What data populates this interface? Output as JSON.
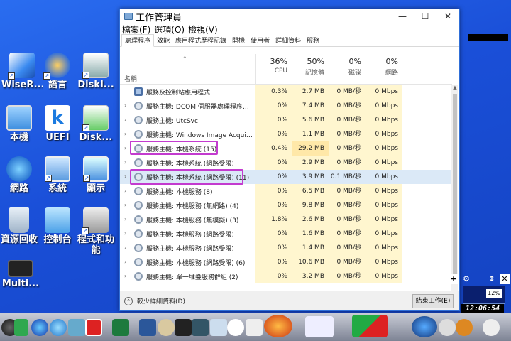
{
  "desktop": {
    "icons": [
      {
        "label": "WiseR..."
      },
      {
        "label": "語言"
      },
      {
        "label": "DiskI..."
      },
      {
        "label": "本機"
      },
      {
        "label": "UEFI"
      },
      {
        "label": "Disk..."
      },
      {
        "label": "網路"
      },
      {
        "label": "系統"
      },
      {
        "label": "顯示"
      },
      {
        "label": "資源回收"
      },
      {
        "label": "控制台"
      },
      {
        "label": "程式和功能"
      },
      {
        "label": "Multi..."
      }
    ]
  },
  "window": {
    "title": "工作管理員",
    "menu": [
      "檔案(F)",
      "選項(O)",
      "檢視(V)"
    ],
    "tabs": [
      "處理程序",
      "效能",
      "應用程式歷程記錄",
      "開機",
      "使用者",
      "詳細資料",
      "服務"
    ],
    "headers": {
      "name": "名稱",
      "cpu_pct": "36%",
      "cpu": "CPU",
      "mem_pct": "50%",
      "mem": "記憶體",
      "disk_pct": "0%",
      "disk": "磁碟",
      "net_pct": "0%",
      "net": "網路"
    },
    "rows": [
      {
        "name": "服務及控制站應用程式",
        "cpu": "0.3%",
        "mem": "2.7 MB",
        "disk": "0 MB/秒",
        "net": "0 Mbps"
      },
      {
        "name": "服務主機: DCOM 伺服器處理程序啟...",
        "cpu": "0%",
        "mem": "7.4 MB",
        "disk": "0 MB/秒",
        "net": "0 Mbps"
      },
      {
        "name": "服務主機: UtcSvc",
        "cpu": "0%",
        "mem": "5.6 MB",
        "disk": "0 MB/秒",
        "net": "0 Mbps"
      },
      {
        "name": "服務主機: Windows Image Acquisitio...",
        "cpu": "0%",
        "mem": "1.1 MB",
        "disk": "0 MB/秒",
        "net": "0 Mbps"
      },
      {
        "name": "服務主機: 本機系統 (15)",
        "cpu": "0.4%",
        "mem": "29.2 MB",
        "disk": "0 MB/秒",
        "net": "0 Mbps"
      },
      {
        "name": "服務主機: 本機系統 (網路受限)",
        "cpu": "0%",
        "mem": "2.9 MB",
        "disk": "0 MB/秒",
        "net": "0 Mbps"
      },
      {
        "name": "服務主機: 本機系統 (網路受限) (11)",
        "cpu": "0%",
        "mem": "3.9 MB",
        "disk": "0.1 MB/秒",
        "net": "0 Mbps"
      },
      {
        "name": "服務主機: 本機服務 (8)",
        "cpu": "0%",
        "mem": "6.5 MB",
        "disk": "0 MB/秒",
        "net": "0 Mbps"
      },
      {
        "name": "服務主機: 本機服務 (無網路) (4)",
        "cpu": "0%",
        "mem": "9.8 MB",
        "disk": "0 MB/秒",
        "net": "0 Mbps"
      },
      {
        "name": "服務主機: 本機服務 (無模擬) (3)",
        "cpu": "1.8%",
        "mem": "2.6 MB",
        "disk": "0 MB/秒",
        "net": "0 Mbps"
      },
      {
        "name": "服務主機: 本機服務 (網路受限)",
        "cpu": "0%",
        "mem": "1.6 MB",
        "disk": "0 MB/秒",
        "net": "0 Mbps"
      },
      {
        "name": "服務主機: 本機服務 (網路受限)",
        "cpu": "0%",
        "mem": "1.4 MB",
        "disk": "0 MB/秒",
        "net": "0 Mbps"
      },
      {
        "name": "服務主機: 本機服務 (網路受限) (6)",
        "cpu": "0%",
        "mem": "10.6 MB",
        "disk": "0 MB/秒",
        "net": "0 Mbps"
      },
      {
        "name": "服務主機: 單一堆疊服務群組 (2)",
        "cpu": "0%",
        "mem": "3.2 MB",
        "disk": "0 MB/秒",
        "net": "0 Mbps"
      }
    ],
    "footer": {
      "less_details": "較少詳細資料(D)",
      "end_task": "結束工作(E)"
    }
  },
  "widgets": {
    "clock": "12:06:54",
    "meter": "12%"
  },
  "colors": {
    "highlight_border": "#c33bcf",
    "usage_fill": "#fff6cf",
    "selection": "#dbe9f7"
  }
}
